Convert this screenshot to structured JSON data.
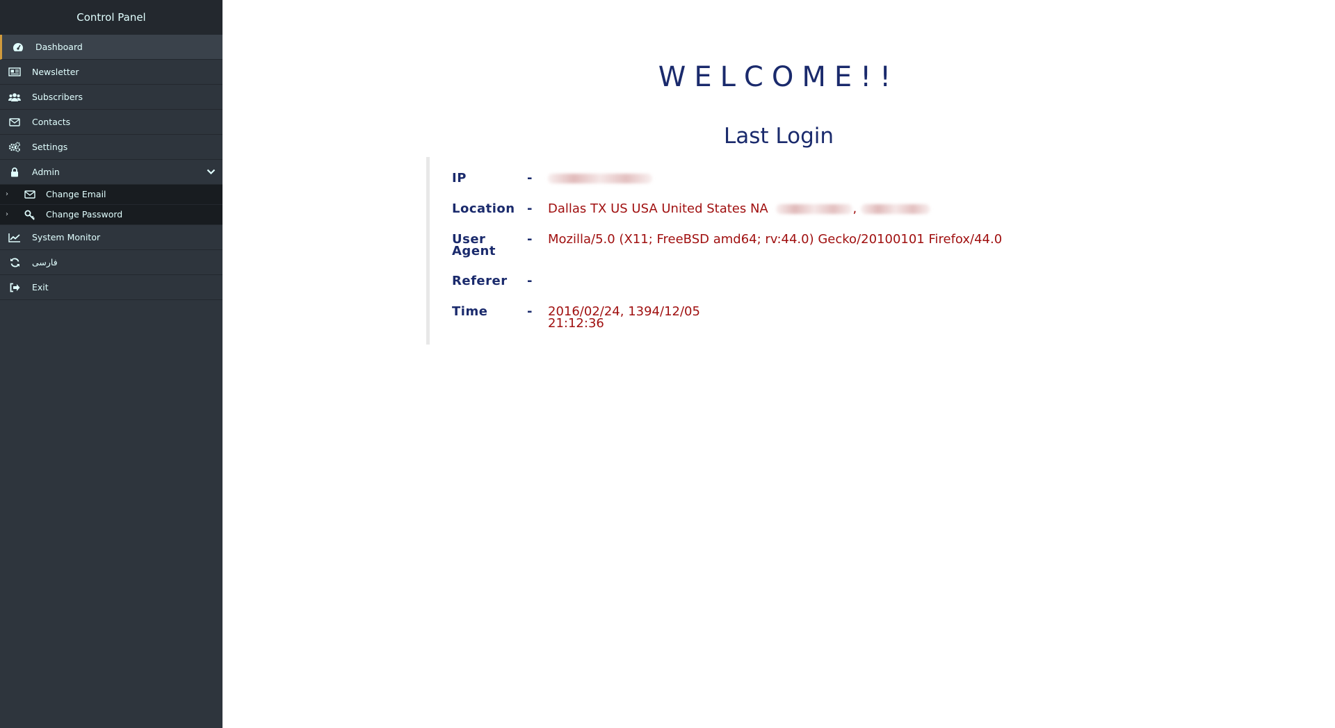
{
  "sidebar": {
    "title": "Control Panel",
    "items": [
      {
        "label": "Dashboard",
        "icon": "dashboard-icon"
      },
      {
        "label": "Newsletter",
        "icon": "newspaper-icon"
      },
      {
        "label": "Subscribers",
        "icon": "users-icon"
      },
      {
        "label": "Contacts",
        "icon": "envelope-icon"
      },
      {
        "label": "Settings",
        "icon": "gears-icon"
      },
      {
        "label": "Admin",
        "icon": "lock-icon",
        "expanded": true,
        "children": [
          {
            "label": "Change Email",
            "icon": "envelope-icon"
          },
          {
            "label": "Change Password",
            "icon": "key-icon"
          }
        ]
      },
      {
        "label": "System Monitor",
        "icon": "line-chart-icon"
      },
      {
        "label": "فارسی",
        "icon": "refresh-icon"
      },
      {
        "label": "Exit",
        "icon": "sign-out-icon"
      }
    ]
  },
  "main": {
    "welcome": "WELCOME!!",
    "subtitle": "Last Login",
    "rows": [
      {
        "label": "IP",
        "sep": "-",
        "value": ""
      },
      {
        "label": "Location",
        "sep": "-",
        "value": "Dallas TX US USA United States NA"
      },
      {
        "label": "User Agent",
        "label_line1": "User",
        "label_line2": "Agent",
        "sep": "-",
        "value": "Mozilla/5.0 (X11; FreeBSD amd64; rv:44.0) Gecko/20100101 Firefox/44.0"
      },
      {
        "label": "Referer",
        "sep": "-",
        "value": ""
      },
      {
        "label": "Time",
        "sep": "-",
        "value_line1": "2016/02/24, 1394/12/05",
        "value_line2": "21:12:36"
      }
    ]
  },
  "colors": {
    "sidebar_bg": "#2e353d",
    "sidebar_header_bg": "#23282e",
    "submenu_bg": "#181c20",
    "active_accent": "#d19b3d",
    "heading_color": "#1a2a6c",
    "value_color": "#a01010"
  }
}
